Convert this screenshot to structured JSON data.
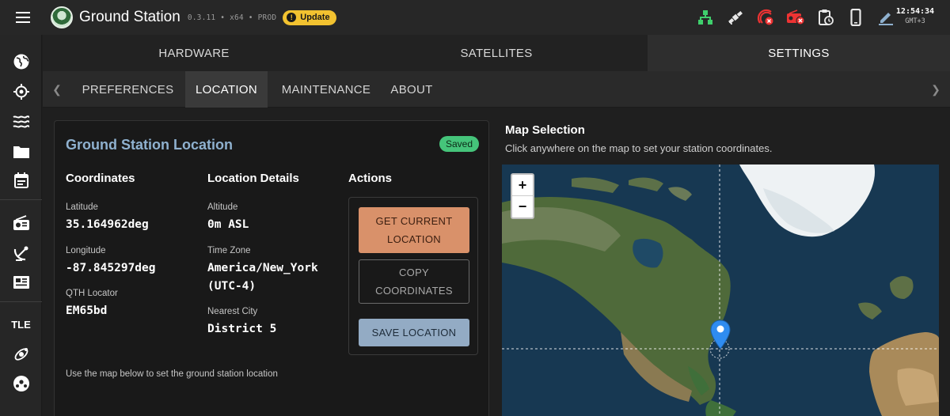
{
  "app": {
    "title": "Ground Station",
    "version": "0.3.11 • x64 • PROD",
    "update_label": "Update"
  },
  "header_icons": [
    "network-tree-icon",
    "satellite-icon",
    "satellite-off-icon",
    "radio-off-icon",
    "clipboard-clock-icon",
    "phone-icon",
    "pencil-icon"
  ],
  "clock": {
    "time": "12:54:34",
    "timezone": "GMT+3"
  },
  "sidebar": {
    "items": [
      "globe-icon",
      "crosshair-icon",
      "waves-icon",
      "folder-icon",
      "calendar-icon",
      "radio-icon",
      "satellite-dish-icon",
      "newspaper-icon",
      "tle",
      "satellite-orbit-icon",
      "soccer-ball-icon"
    ],
    "tle_label": "TLE"
  },
  "main_tabs": [
    "HARDWARE",
    "SATELLITES",
    "SETTINGS"
  ],
  "sub_tabs": [
    "PREFERENCES",
    "LOCATION",
    "MAINTENANCE",
    "ABOUT"
  ],
  "card": {
    "title": "Ground Station Location",
    "status": "Saved",
    "coordinates_heading": "Coordinates",
    "details_heading": "Location Details",
    "actions_heading": "Actions",
    "latitude_label": "Latitude",
    "latitude_value": "35.164962deg",
    "longitude_label": "Longitude",
    "longitude_value": "-87.845297deg",
    "qth_label": "QTH Locator",
    "qth_value": "EM65bd",
    "altitude_label": "Altitude",
    "altitude_value": "0m ASL",
    "timezone_label": "Time Zone",
    "timezone_value_line1": "America/New_York",
    "timezone_value_line2": "(UTC-4)",
    "city_label": "Nearest City",
    "city_value": "District 5",
    "btn_current_line1": "GET CURRENT",
    "btn_current_line2": "LOCATION",
    "btn_copy_line1": "COPY",
    "btn_copy_line2": "COORDINATES",
    "btn_save": "SAVE LOCATION",
    "hint": "Use the map below to set the ground station location"
  },
  "map": {
    "title": "Map Selection",
    "subtitle": "Click anywhere on the map to set your station coordinates.",
    "zoom_in": "+",
    "zoom_out": "−"
  },
  "colors": {
    "accent_blue": "#8fb1cf",
    "saved_green": "#45c47a",
    "primary_orange": "#d9916a",
    "marker_blue": "#2f8cf0"
  }
}
